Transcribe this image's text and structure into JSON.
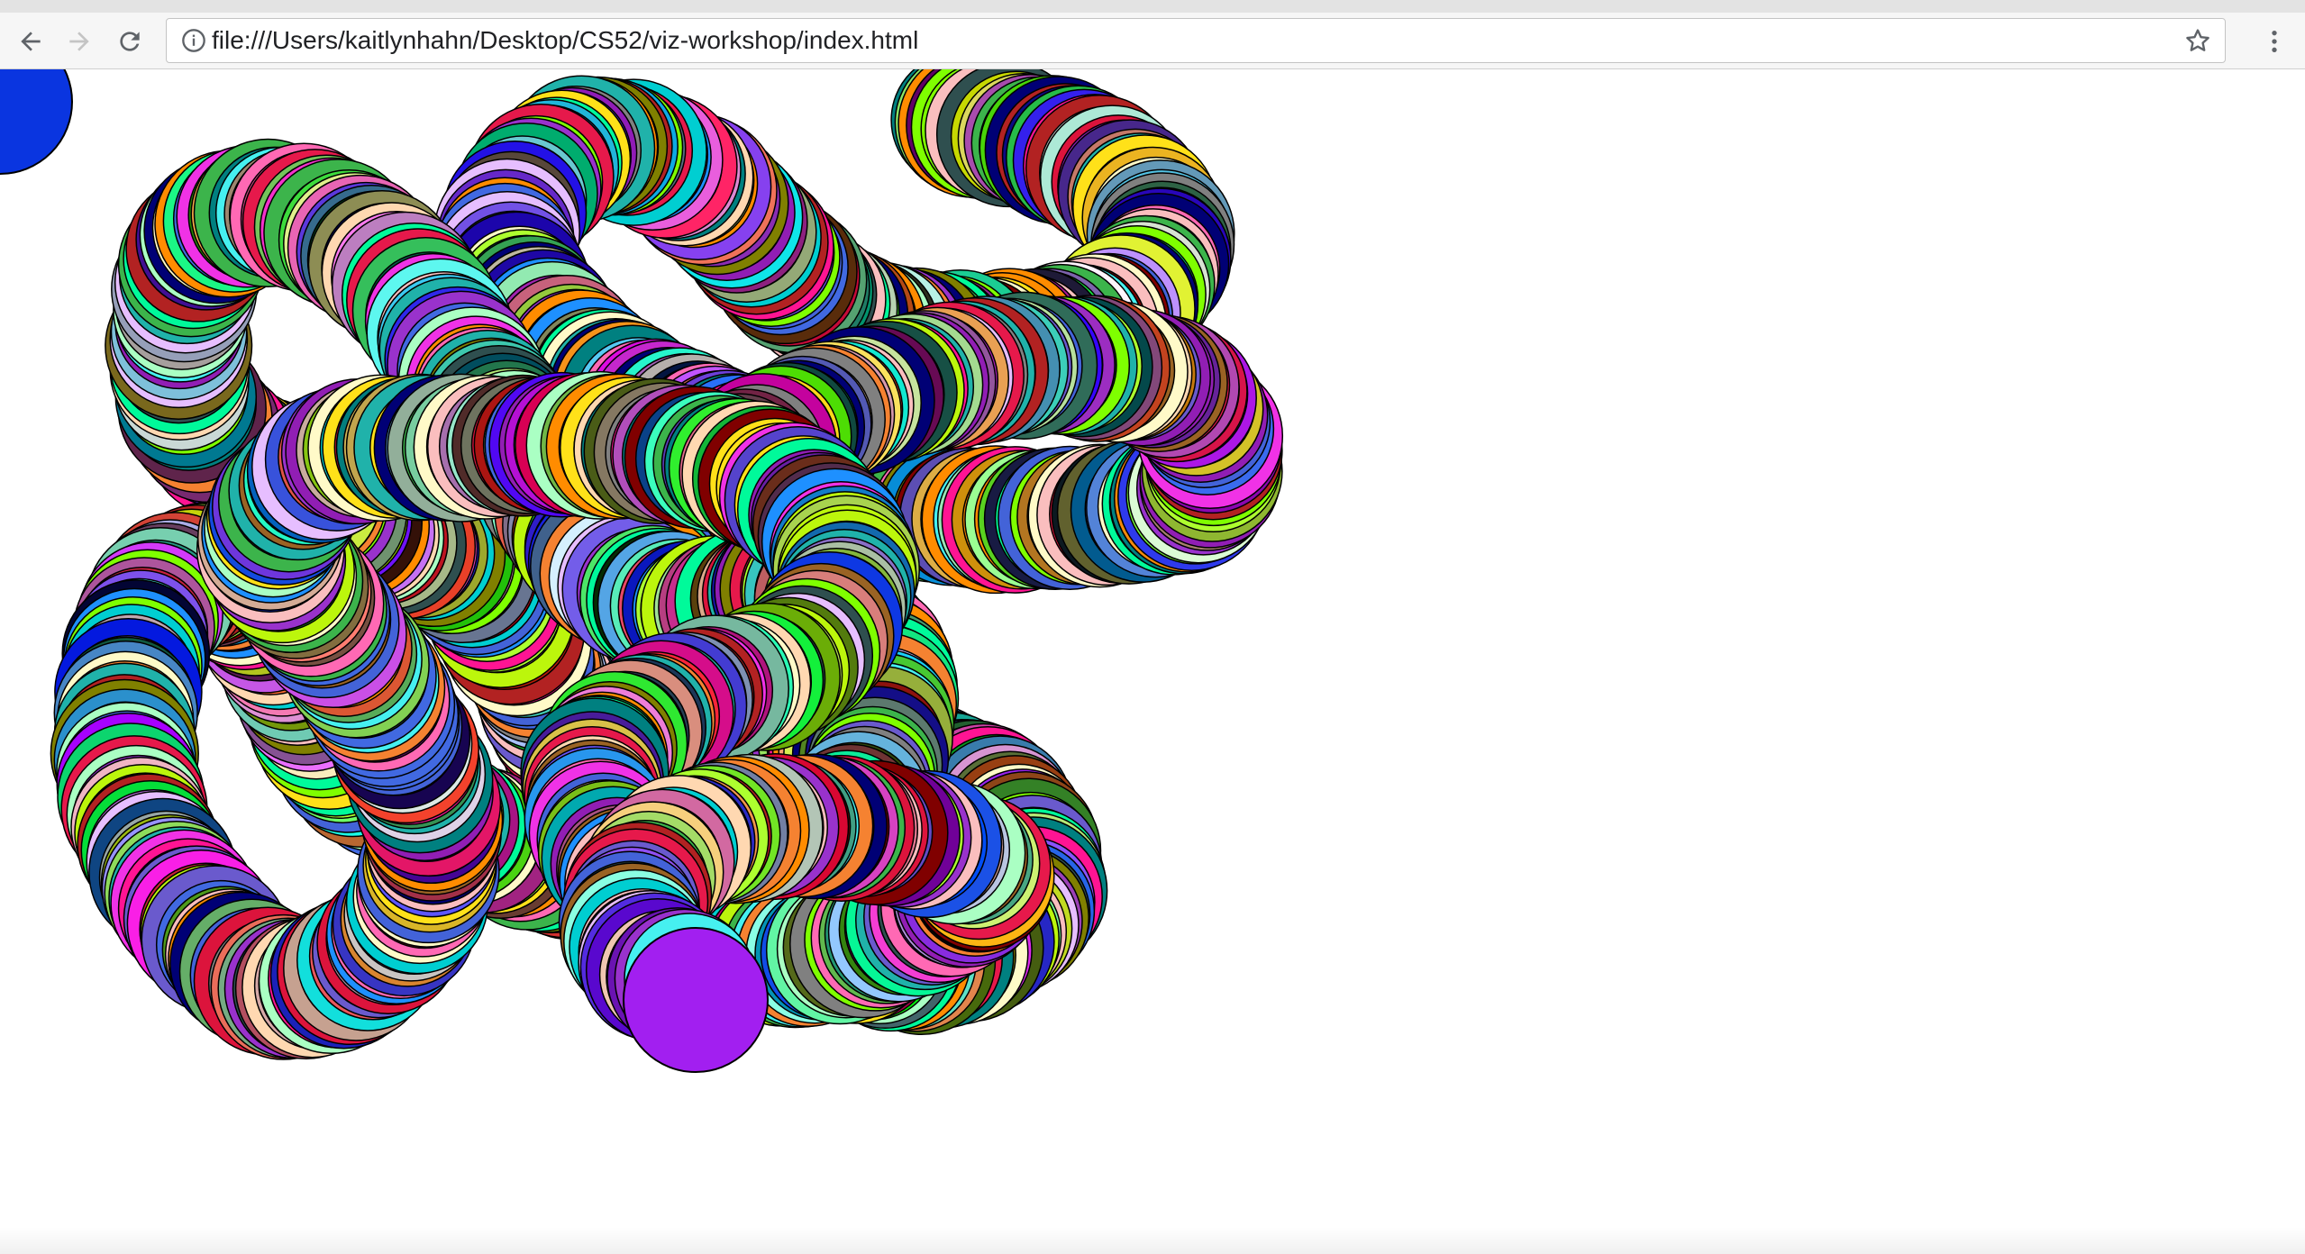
{
  "browser": {
    "url": "file:///Users/kaitlynhahn/Desktop/CS52/viz-workshop/index.html",
    "icons": {
      "back": "back-arrow-icon",
      "forward": "forward-arrow-icon",
      "reload": "reload-icon",
      "info": "info-icon",
      "bookmark": "star-icon",
      "menu": "kebab-menu-icon"
    }
  },
  "visualization": {
    "description_note": "",
    "corner_circle_color": "#0a35e0",
    "last_circle_color": "#a21ff0",
    "stroke_color": "#000000"
  }
}
